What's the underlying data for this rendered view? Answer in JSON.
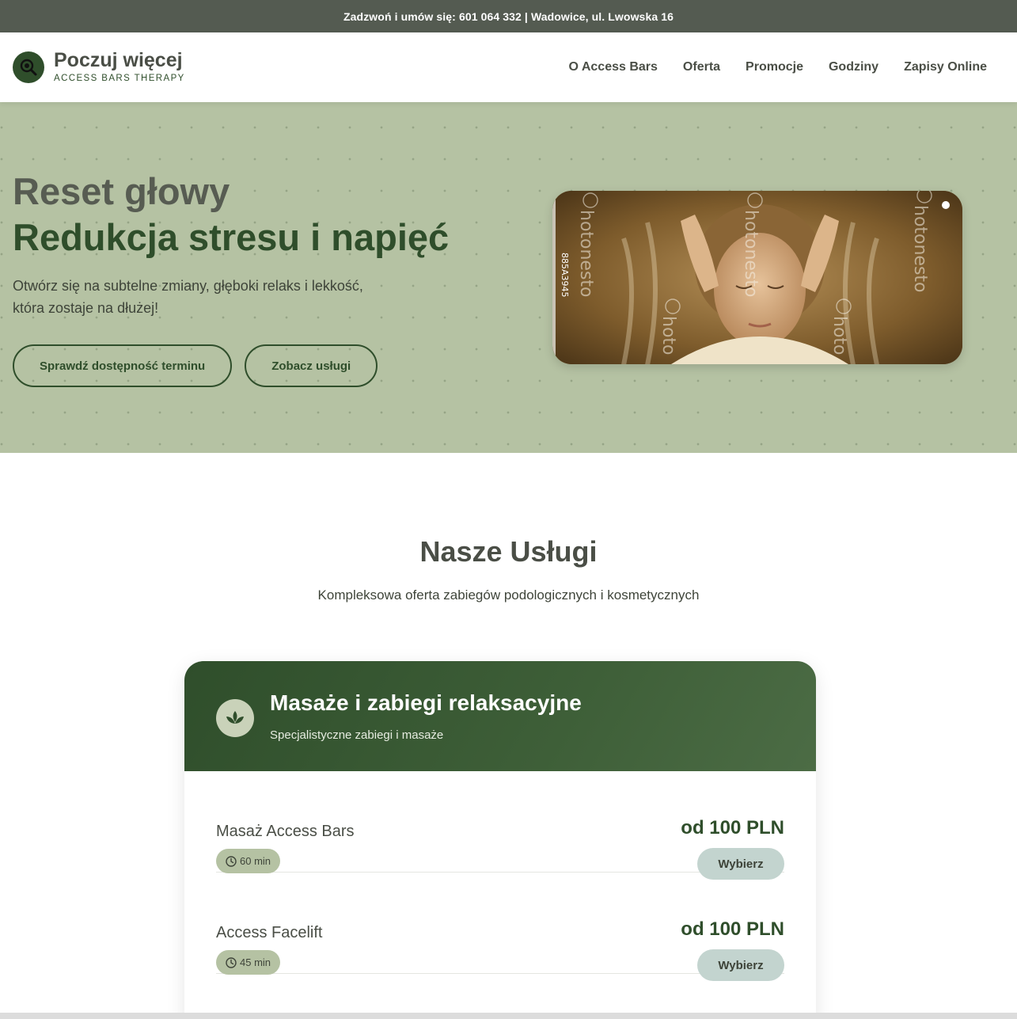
{
  "topbar": {
    "call_label": "Zadzwoń i umów się:",
    "phone": "601 064 332",
    "separator": "|",
    "address": "Wadowice, ul. Lwowska 16"
  },
  "header": {
    "brand": "Poczuj więcej",
    "tagline": "ACCESS BARS THERAPY",
    "nav": [
      "O Access Bars",
      "Oferta",
      "Promocje",
      "Godziny",
      "Zapisy Online"
    ]
  },
  "hero": {
    "title_line1": "Reset głowy",
    "title_line2": "Redukcja stresu i napięć",
    "description": "Otwórz się na subtelne zmiany, głęboki relaks i lekkość, która zostaje na dłużej!",
    "button_check": "Sprawdź dostępność terminu",
    "button_services": "Zobacz usługi",
    "image_watermark": "Photonesto",
    "image_code": "885A3945"
  },
  "services": {
    "title": "Nasze Usługi",
    "subtitle": "Kompleksowa oferta zabiegów podologicznych i kosmetycznych",
    "category": {
      "title": "Masaże i zabiegi relaksacyjne",
      "subtitle": "Specjalistyczne zabiegi i masaże",
      "icon": "lotus-icon",
      "items": [
        {
          "name": "Masaż Access Bars",
          "duration": "60 min",
          "price": "od 100 PLN",
          "button": "Wybierz"
        },
        {
          "name": "Access Facelift",
          "duration": "45 min",
          "price": "od 100 PLN",
          "button": "Wybierz"
        }
      ]
    }
  },
  "colors": {
    "topbar": "#545b51",
    "accent": "#2f4e2b",
    "hero_bg": "#b5c2a3",
    "button_pale": "#c3d4cf"
  }
}
